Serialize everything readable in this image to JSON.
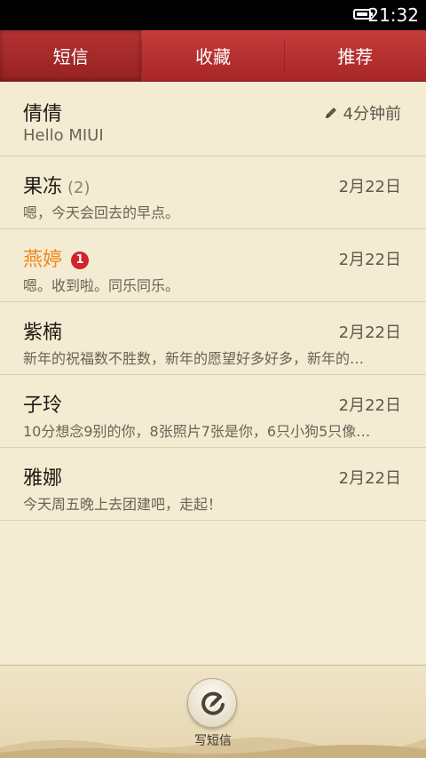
{
  "status_bar": {
    "time": "21:32",
    "battery_icon": "battery-icon"
  },
  "tabs": [
    {
      "label": "短信",
      "active": true
    },
    {
      "label": "收藏",
      "active": false
    },
    {
      "label": "推荐",
      "active": false
    }
  ],
  "conversations": [
    {
      "name": "倩倩",
      "count": "",
      "unread_badge": "",
      "time": "4分钟前",
      "draft_icon": "pencil-icon",
      "preview": "Hello MIUI"
    },
    {
      "name": "果冻",
      "count": "(2)",
      "unread_badge": "",
      "time": "2月22日",
      "preview": "嗯，今天会回去的早点。"
    },
    {
      "name": "燕婷",
      "count": "",
      "unread_badge": "1",
      "time": "2月22日",
      "preview": "嗯。收到啦。同乐同乐。"
    },
    {
      "name": "紫楠",
      "count": "",
      "unread_badge": "",
      "time": "2月22日",
      "preview": "新年的祝福数不胜数，新年的愿望好多好多，新年的…"
    },
    {
      "name": "子玲",
      "count": "",
      "unread_badge": "",
      "time": "2月22日",
      "preview": "10分想念9别的你，8张照片7张是你，6只小狗5只像…"
    },
    {
      "name": "雅娜",
      "count": "",
      "unread_badge": "",
      "time": "2月22日",
      "preview": "今天周五晚上去团建吧，走起！"
    }
  ],
  "bottom_bar": {
    "compose_label": "写短信",
    "compose_icon": "compose-icon"
  },
  "colors": {
    "tab_red": "#c63b3b",
    "background": "#f4ebd3",
    "unread_name": "#ee8a1a",
    "badge_red": "#d1242b"
  }
}
